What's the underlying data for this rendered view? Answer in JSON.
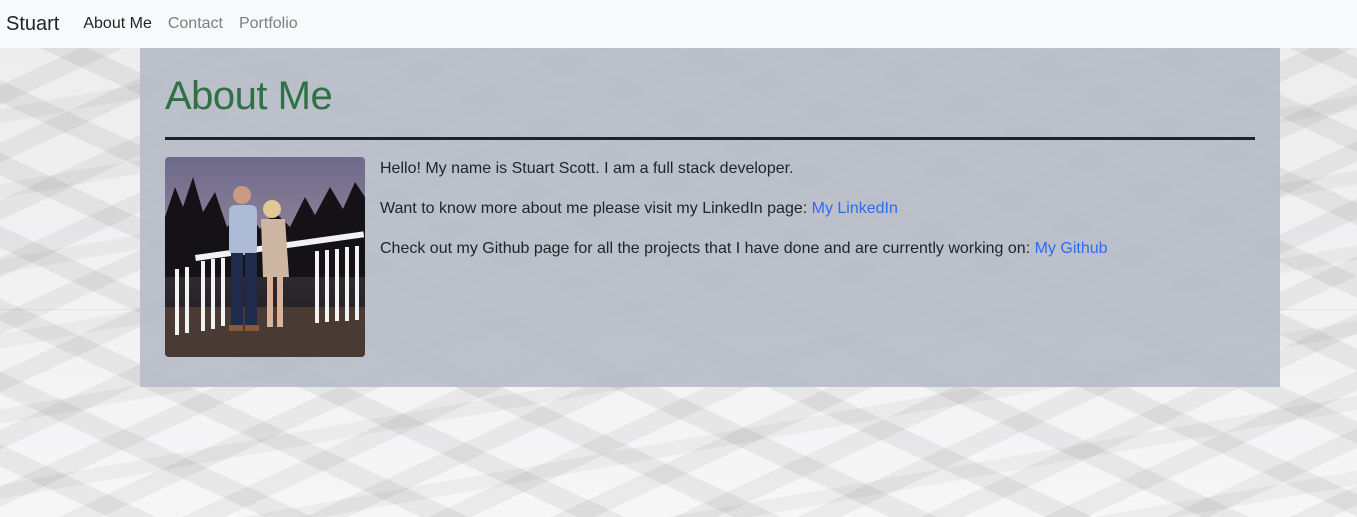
{
  "navbar": {
    "brand": "Stuart",
    "links": [
      {
        "label": "About Me",
        "active": true
      },
      {
        "label": "Contact",
        "active": false
      },
      {
        "label": "Portfolio",
        "active": false
      }
    ]
  },
  "main": {
    "title": "About Me",
    "paragraphs": {
      "intro": "Hello! My name is Stuart Scott. I am a full stack developer.",
      "linkedin_text": "Want to know more about me please visit my LinkedIn page: ",
      "linkedin_link": "My LinkedIn",
      "github_text": "Check out my Github page for all the projects that I have done and are currently working on: ",
      "github_link": "My Github"
    },
    "photo_icon": "profile-photo"
  },
  "colors": {
    "title": "#2f7145",
    "link": "#2b6cf0",
    "panel": "#b7bcc7",
    "navbar": "#f8f9fa"
  }
}
